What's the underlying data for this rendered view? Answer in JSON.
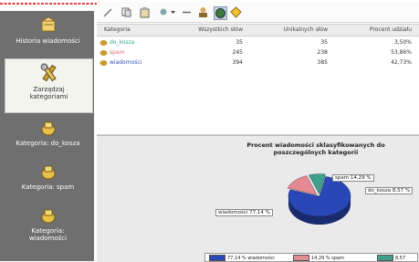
{
  "sidebar": {
    "items": [
      {
        "label": "Historia wiadomości",
        "selected": false
      },
      {
        "label": "Zarządzaj kategoriami",
        "selected": true
      },
      {
        "label": "Kategoria: do_kosza",
        "selected": false
      },
      {
        "label": "Kategoria: spam",
        "selected": false
      },
      {
        "label": "Kategoria: wiadomości",
        "selected": false
      }
    ]
  },
  "toolbar": {
    "icons": [
      "arrow-icon",
      "copy-icon",
      "paste-icon",
      "dropdown-icon",
      "remove-icon",
      "person-icon",
      "globe-icon",
      "shield-icon"
    ]
  },
  "table": {
    "headers": [
      "Kategoria",
      "Wszystkich słów",
      "Unikalnych słów",
      "Procent udziału"
    ],
    "rows": [
      {
        "name": "do_kosza",
        "total": "35",
        "unique": "35",
        "percent": "3,50%",
        "color": "#3aa88f"
      },
      {
        "name": "spam",
        "total": "245",
        "unique": "238",
        "percent": "53,86%",
        "color": "#e06a78"
      },
      {
        "name": "wiadomości",
        "total": "394",
        "unique": "385",
        "percent": "42,73%",
        "color": "#2f4fb0"
      }
    ]
  },
  "chart_data": {
    "type": "pie",
    "title": "Procent wiadomości sklasyfikowanych do poszczególnych kategorii",
    "slices": [
      {
        "label": "wiadomości 77,14 %",
        "value": 77.14,
        "color": "#2a47b8"
      },
      {
        "label": "spam 14,29 %",
        "value": 14.29,
        "color": "#e48a92"
      },
      {
        "label": "do_kosza 8,57 %",
        "value": 8.57,
        "color": "#3f9f8e"
      }
    ],
    "legend": [
      {
        "text": "77,14 % wiadomości",
        "color": "#2a47b8"
      },
      {
        "text": "14,29 % spam",
        "color": "#e48a92"
      },
      {
        "text": "8,57",
        "color": "#3f9f8e"
      }
    ]
  }
}
